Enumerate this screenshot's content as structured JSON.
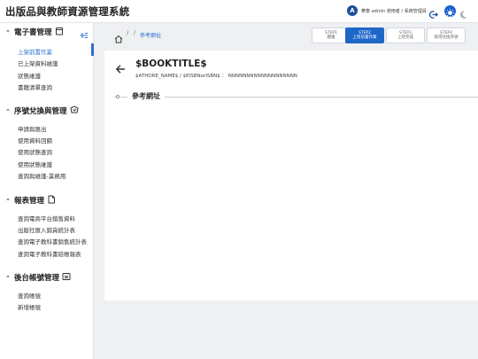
{
  "header": {
    "app_title": "出版品與教師資源管理系統",
    "user_initial": "A",
    "user_label": "華泰 admin 使用者 / 系統管理員",
    "logout_icon": "logout-icon",
    "theme_icons": [
      "sun-icon",
      "moon-icon"
    ]
  },
  "sidebar": {
    "collapse_icon": "collapse-sidebar-icon",
    "sections": [
      {
        "title": "電子書管理",
        "icon": "ebook-icon",
        "items": [
          "上架前置作業",
          "已上架資料維護",
          "狀態維護",
          "書籍清單查詢"
        ]
      },
      {
        "title": "序號兌換與管理",
        "icon": "ticket-icon",
        "items": [
          "申請與匯出",
          "使用資料回饋",
          "使用狀態查詢",
          "使用狀態維護",
          "查詢與維護-業務用"
        ]
      },
      {
        "title": "報表管理",
        "icon": "report-icon",
        "items": [
          "查詢電商平台銷售資料",
          "出版社匯入銷貨統計表",
          "查詢電子教科書銷售統計表",
          "查詢電子教科書結帳報表"
        ]
      },
      {
        "title": "後台帳號管理",
        "icon": "account-icon",
        "items": [
          "查詢帳號",
          "新增帳號"
        ]
      }
    ]
  },
  "breadcrumb": {
    "separator_1": "/",
    "separator_2": "/",
    "current": "參考網址"
  },
  "steps": [
    {
      "no": "STEP1",
      "label": "圖書"
    },
    {
      "no": "STEP2",
      "label": "上架前置作業"
    },
    {
      "no": "STEP3",
      "label": "上架完成"
    },
    {
      "no": "STEP4",
      "label": "取得兌換序號"
    }
  ],
  "active_step": 2,
  "content": {
    "book_title": "$BOOKTITLE$",
    "book_meta": "$ATHORE_NAME$ / $EISBNorISBN$ ： NNNNNNNNNNNNNNNNNNN",
    "section_title": "參考網址"
  },
  "colors": {
    "accent": "#2f6fd0",
    "step_active": "#1f66c9",
    "avatar": "#1c4f9c"
  }
}
